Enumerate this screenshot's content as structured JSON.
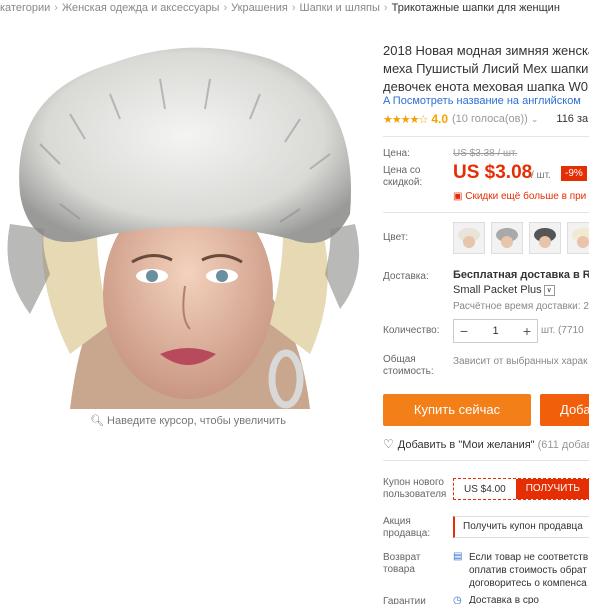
{
  "breadcrumb": {
    "items": [
      "категории",
      "Женская одежда и аксессуары",
      "Украшения",
      "Шапки и шляпы"
    ],
    "current": "Трикотажные шапки для женщин",
    "sep": "›"
  },
  "product": {
    "zoom_hint": "Наведите курсор, чтобы увеличить",
    "title_lines": [
      "2018 Новая модная зимняя женская",
      "меха Пушистый Лисий Мех шапки,",
      "девочек енота меховая шапка W0"
    ],
    "translate_link": "Посмотреть название на английском",
    "stars": "★★★★☆",
    "rating": "4.0",
    "votes": "(10 голоса(ов))",
    "orders": "116 за"
  },
  "price": {
    "label": "Цена:",
    "old": "US $3.38 / шт.",
    "discount_label": "Цена со скидкой:",
    "new": "US $3.08",
    "unit": "/ шт.",
    "discount": "-9%",
    "sale_note": "Скидки ещё больше в при"
  },
  "color": {
    "label": "Цвет:"
  },
  "shipping": {
    "label": "Доставка:",
    "line1": "Бесплатная доставка в Rus",
    "line2": "Small Packet Plus",
    "time": "Расчётное время доставки: 2"
  },
  "quantity": {
    "label": "Количество:",
    "minus": "−",
    "value": "1",
    "plus": "+",
    "unit": "шт. (7710"
  },
  "total": {
    "label": "Общая стоимость:",
    "note": "Зависит от выбранных харак"
  },
  "actions": {
    "buy": "Купить сейчас",
    "cart": "Доба"
  },
  "wishlist": {
    "label": "Добавить в \"Мои желания\"",
    "count": "(611 добави"
  },
  "coupon": {
    "label": "Купон нового пользователя",
    "amount": "US $4.00",
    "get": "ПОЛУЧИТЬ"
  },
  "promo": {
    "label": "Акция продавца:",
    "text": "Получить купон продавца"
  },
  "returns": {
    "label": "Возврат товара",
    "lines": [
      "Если товар не соответств",
      "оплатив стоимость обрат",
      "договоритесь о компенса"
    ]
  },
  "guarantee": {
    "label": "Гарантии",
    "text": "Доставка в сро"
  },
  "colors": {
    "accent": "#e62e04",
    "buy": "#f37f18",
    "cart": "#f25f0b",
    "link": "#2d6fd5"
  }
}
